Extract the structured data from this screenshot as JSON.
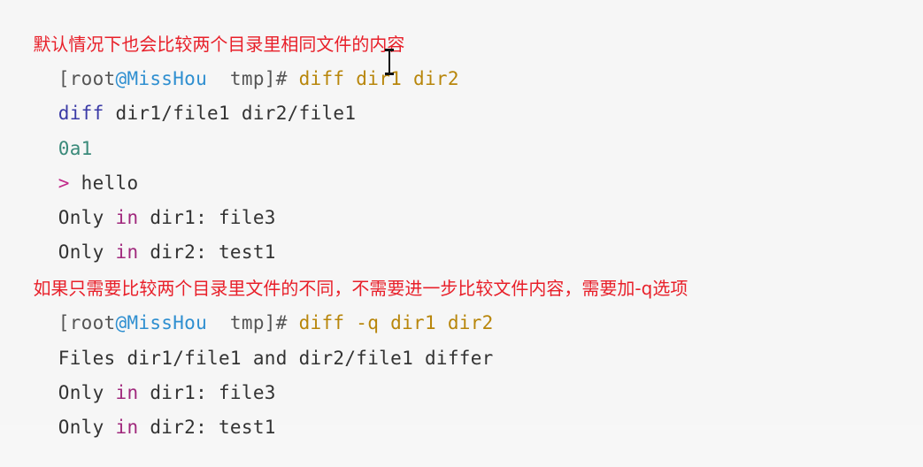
{
  "colors": {
    "note": "#e8202a",
    "user": "#555555",
    "host": "#2f8fd0",
    "path": "#555555",
    "command": "#b8860b",
    "keyword": "#3a3aa6",
    "text": "#333333",
    "diff_marker": "#c22a8a",
    "in_keyword": "#a0287c",
    "hunk": "#3a8a7a"
  },
  "lines": [
    {
      "segments": [
        {
          "text": "默认情况下也会比较两个目录里相同文件的内容",
          "role": "note"
        }
      ]
    },
    {
      "segments": [
        {
          "text": "[root",
          "role": "user"
        },
        {
          "text": "@MissHou",
          "role": "host"
        },
        {
          "text": "  tmp]# ",
          "role": "path"
        },
        {
          "text": "diff dir1 dir2",
          "role": "command"
        }
      ]
    },
    {
      "segments": [
        {
          "text": "diff",
          "role": "keyword"
        },
        {
          "text": " dir1/file1 dir2/file1",
          "role": "text"
        }
      ]
    },
    {
      "segments": [
        {
          "text": "0a1",
          "role": "hunk"
        }
      ]
    },
    {
      "segments": [
        {
          "text": ">",
          "role": "diff_marker"
        },
        {
          "text": " hello",
          "role": "text"
        }
      ]
    },
    {
      "segments": [
        {
          "text": "Only ",
          "role": "text"
        },
        {
          "text": "in",
          "role": "in_keyword"
        },
        {
          "text": " dir1: file3",
          "role": "text"
        }
      ]
    },
    {
      "segments": [
        {
          "text": "Only ",
          "role": "text"
        },
        {
          "text": "in",
          "role": "in_keyword"
        },
        {
          "text": " dir2: test1",
          "role": "text"
        }
      ]
    },
    {
      "segments": [
        {
          "text": "如果只需要比较两个目录里文件的不同，不需要进一步比较文件内容，需要加-q选项",
          "role": "note"
        }
      ]
    },
    {
      "segments": [
        {
          "text": "[root",
          "role": "user"
        },
        {
          "text": "@MissHou",
          "role": "host"
        },
        {
          "text": "  tmp]# ",
          "role": "path"
        },
        {
          "text": "diff -q dir1 dir2",
          "role": "command"
        }
      ]
    },
    {
      "segments": [
        {
          "text": "Files dir1/file1 and dir2/file1 differ",
          "role": "text"
        }
      ]
    },
    {
      "segments": [
        {
          "text": "Only ",
          "role": "text"
        },
        {
          "text": "in",
          "role": "in_keyword"
        },
        {
          "text": " dir1: file3",
          "role": "text"
        }
      ]
    },
    {
      "segments": [
        {
          "text": "Only ",
          "role": "text"
        },
        {
          "text": "in",
          "role": "in_keyword"
        },
        {
          "text": " dir2: test1",
          "role": "text"
        }
      ]
    }
  ],
  "cursor": {
    "icon": "text-cursor-icon"
  }
}
